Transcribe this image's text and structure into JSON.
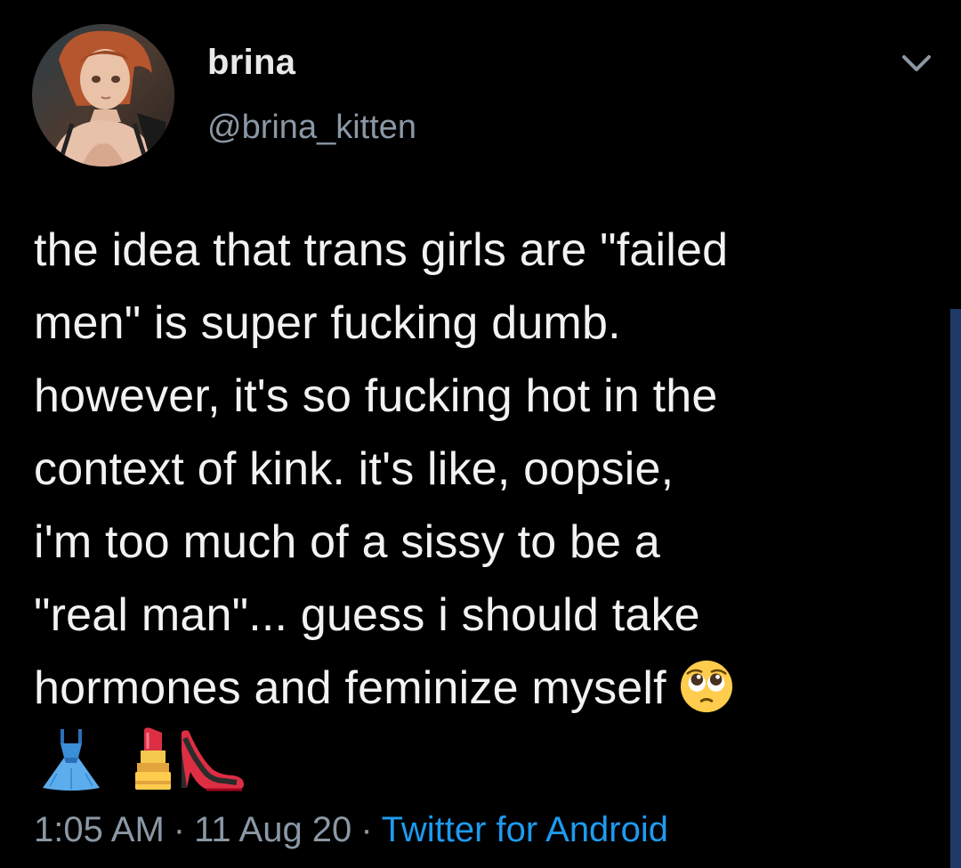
{
  "author": {
    "display_name": "brina",
    "handle": "@brina_kitten",
    "avatar": "anime-avatar"
  },
  "header": {
    "more_icon": "chevron-down-icon"
  },
  "tweet": {
    "text_lines": [
      "the idea that trans girls are \"failed",
      "men\" is super fucking dumb.",
      "however, it's so fucking hot in the",
      "context of kink. it's like, oopsie,",
      "i'm too much of a sissy to be a",
      "\"real man\"... guess i should take",
      "hormones and feminize myself"
    ],
    "emojis": [
      "pleading-face-icon",
      "dress-icon",
      "lipstick-icon",
      "high-heel-icon"
    ]
  },
  "meta": {
    "time": "1:05 AM",
    "separator": "·",
    "date": "11 Aug 20",
    "source": "Twitter for Android"
  },
  "colors": {
    "background": "#000000",
    "text": "#f2f2f2",
    "secondary": "#8b98a5",
    "link": "#1d9bf0"
  }
}
